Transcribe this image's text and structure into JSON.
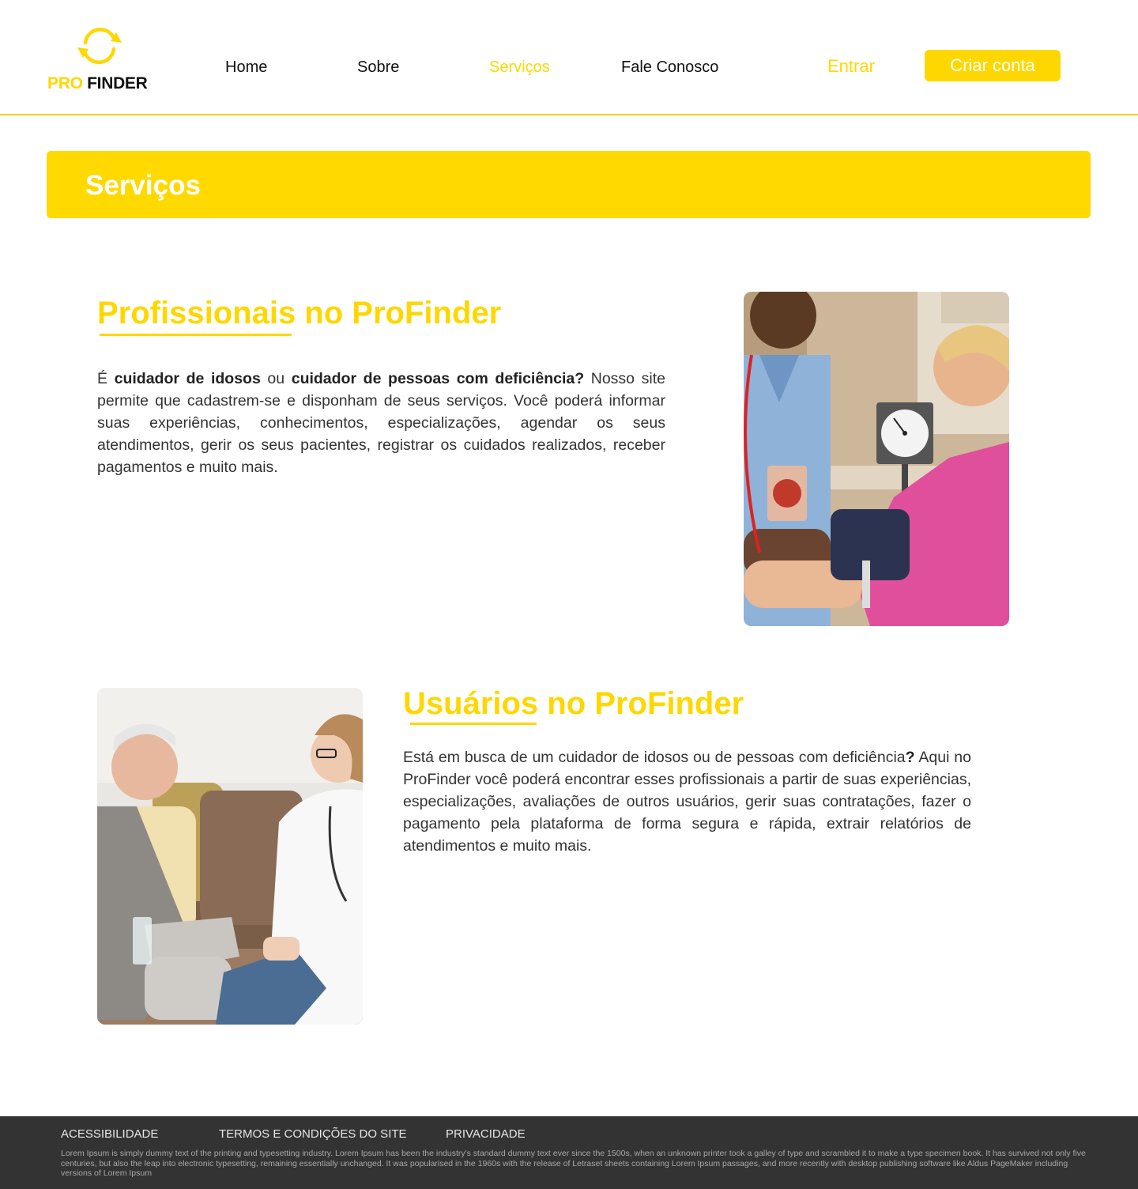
{
  "brand": {
    "logo_pro": "PRO",
    "logo_finder": " FINDER",
    "accent_color": "#FFD700"
  },
  "nav": {
    "items": [
      {
        "label": "Home",
        "active": false
      },
      {
        "label": "Sobre",
        "active": false
      },
      {
        "label": "Serviços",
        "active": true
      },
      {
        "label": "Fale Conosco",
        "active": false
      }
    ],
    "login_label": "Entrar",
    "signup_label": "Criar conta"
  },
  "banner": {
    "title": "Serviços"
  },
  "professionals": {
    "title": "Profissionais no ProFinder",
    "text_parts": {
      "p1": "É ",
      "b1": "cuidador de idosos",
      "p2": " ou ",
      "b2": "cuidador de pessoas com deficiência?",
      "p3": "  Nosso site permite que cadastrem-se e disponham de seus serviços. Você poderá informar suas experiências, conhecimentos, especializações, agendar os seus atendimentos, gerir os seus pacientes, registrar os cuidados realizados, receber pagamentos e muito mais."
    }
  },
  "users": {
    "title": "Usuários no ProFinder",
    "text_parts": {
      "p1": "Está em busca de um cuidador de idosos ou de pessoas com deficiência",
      "b1": "?",
      "p2": " Aqui no ProFinder você poderá encontrar esses profissionais a partir de suas experiências, especializações, avaliações de outros usuários, gerir suas contratações, fazer o pagamento pela plataforma de forma segura e rápida, extrair relatórios de atendimentos e muito mais."
    }
  },
  "footer": {
    "links": [
      "ACESSIBILIDADE",
      "TERMOS E CONDIÇÕES DO SITE",
      "PRIVACIDADE"
    ],
    "text": "Lorem Ipsum is simply dummy text of the printing and typesetting industry. Lorem Ipsum has been the industry's standard dummy text ever since the 1500s, when an unknown printer took a galley of type and scrambled it to make a type specimen book. It has survived not only five centuries, but also the leap into electronic typesetting, remaining essentially unchanged. It was popularised in the 1960s with the release of Letraset sheets containing Lorem Ipsum passages, and more recently with desktop publishing software like Aldus PageMaker including versions of Lorem Ipsum"
  }
}
